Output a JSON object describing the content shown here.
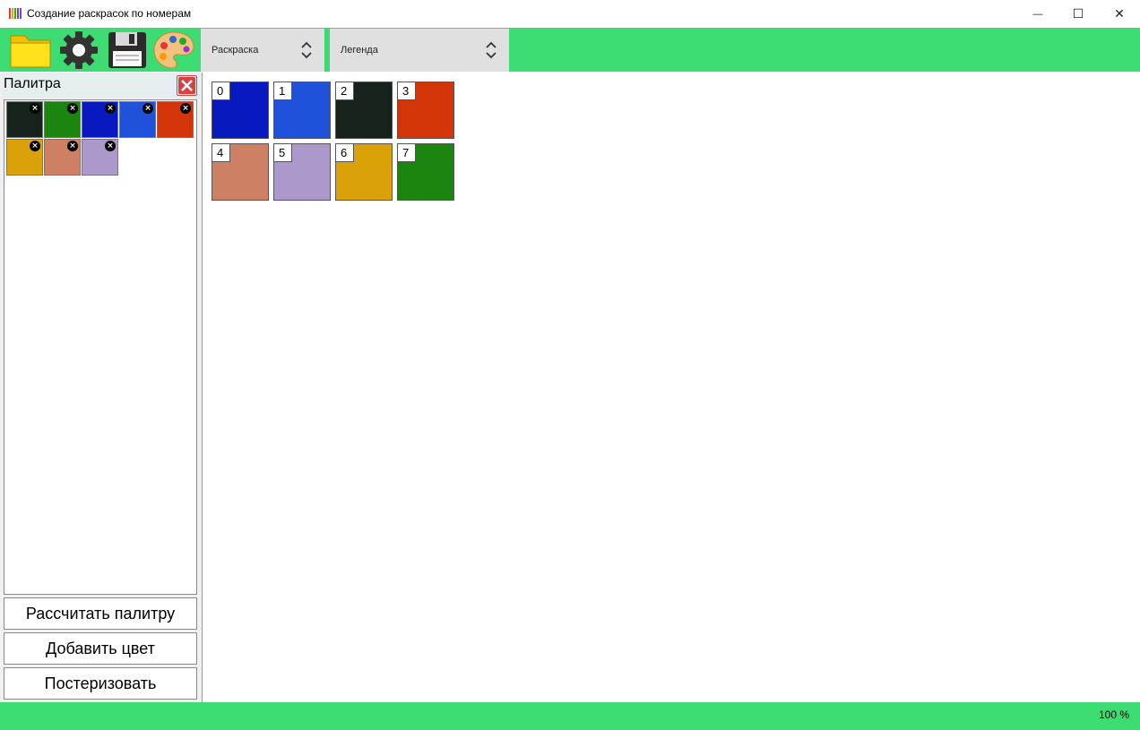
{
  "window": {
    "title": "Создание раскрасок по номерам",
    "minimize_glyph": "—",
    "maximize_glyph": "☐",
    "close_glyph": "✕"
  },
  "toolbar": {
    "icons": [
      "open-folder-icon",
      "settings-gear-icon",
      "save-floppy-icon",
      "palette-icon"
    ],
    "dropdown_mode": {
      "value": "Раскраска"
    },
    "dropdown_view": {
      "value": "Легенда"
    }
  },
  "palette": {
    "title": "Палитра",
    "remove_glyph": "×",
    "swatches": [
      {
        "color": "#16231c"
      },
      {
        "color": "#1c8510"
      },
      {
        "color": "#0819c0"
      },
      {
        "color": "#1f51db"
      },
      {
        "color": "#d33408"
      },
      {
        "color": "#dba108"
      },
      {
        "color": "#cd8063"
      },
      {
        "color": "#ab99cb"
      }
    ],
    "buttons": {
      "calculate": "Рассчитать палитру",
      "add_color": "Добавить цвет",
      "posterize": "Постеризовать"
    }
  },
  "legend": {
    "tiles": [
      {
        "number": "0",
        "color": "#0819c0"
      },
      {
        "number": "1",
        "color": "#1f51db"
      },
      {
        "number": "2",
        "color": "#16231c"
      },
      {
        "number": "3",
        "color": "#d33408"
      },
      {
        "number": "4",
        "color": "#cd8063"
      },
      {
        "number": "5",
        "color": "#ab99cb"
      },
      {
        "number": "6",
        "color": "#dba108"
      },
      {
        "number": "7",
        "color": "#1c8510"
      }
    ]
  },
  "status": {
    "zoom": "100 %"
  },
  "colors": {
    "accent": "#3ddc72"
  }
}
